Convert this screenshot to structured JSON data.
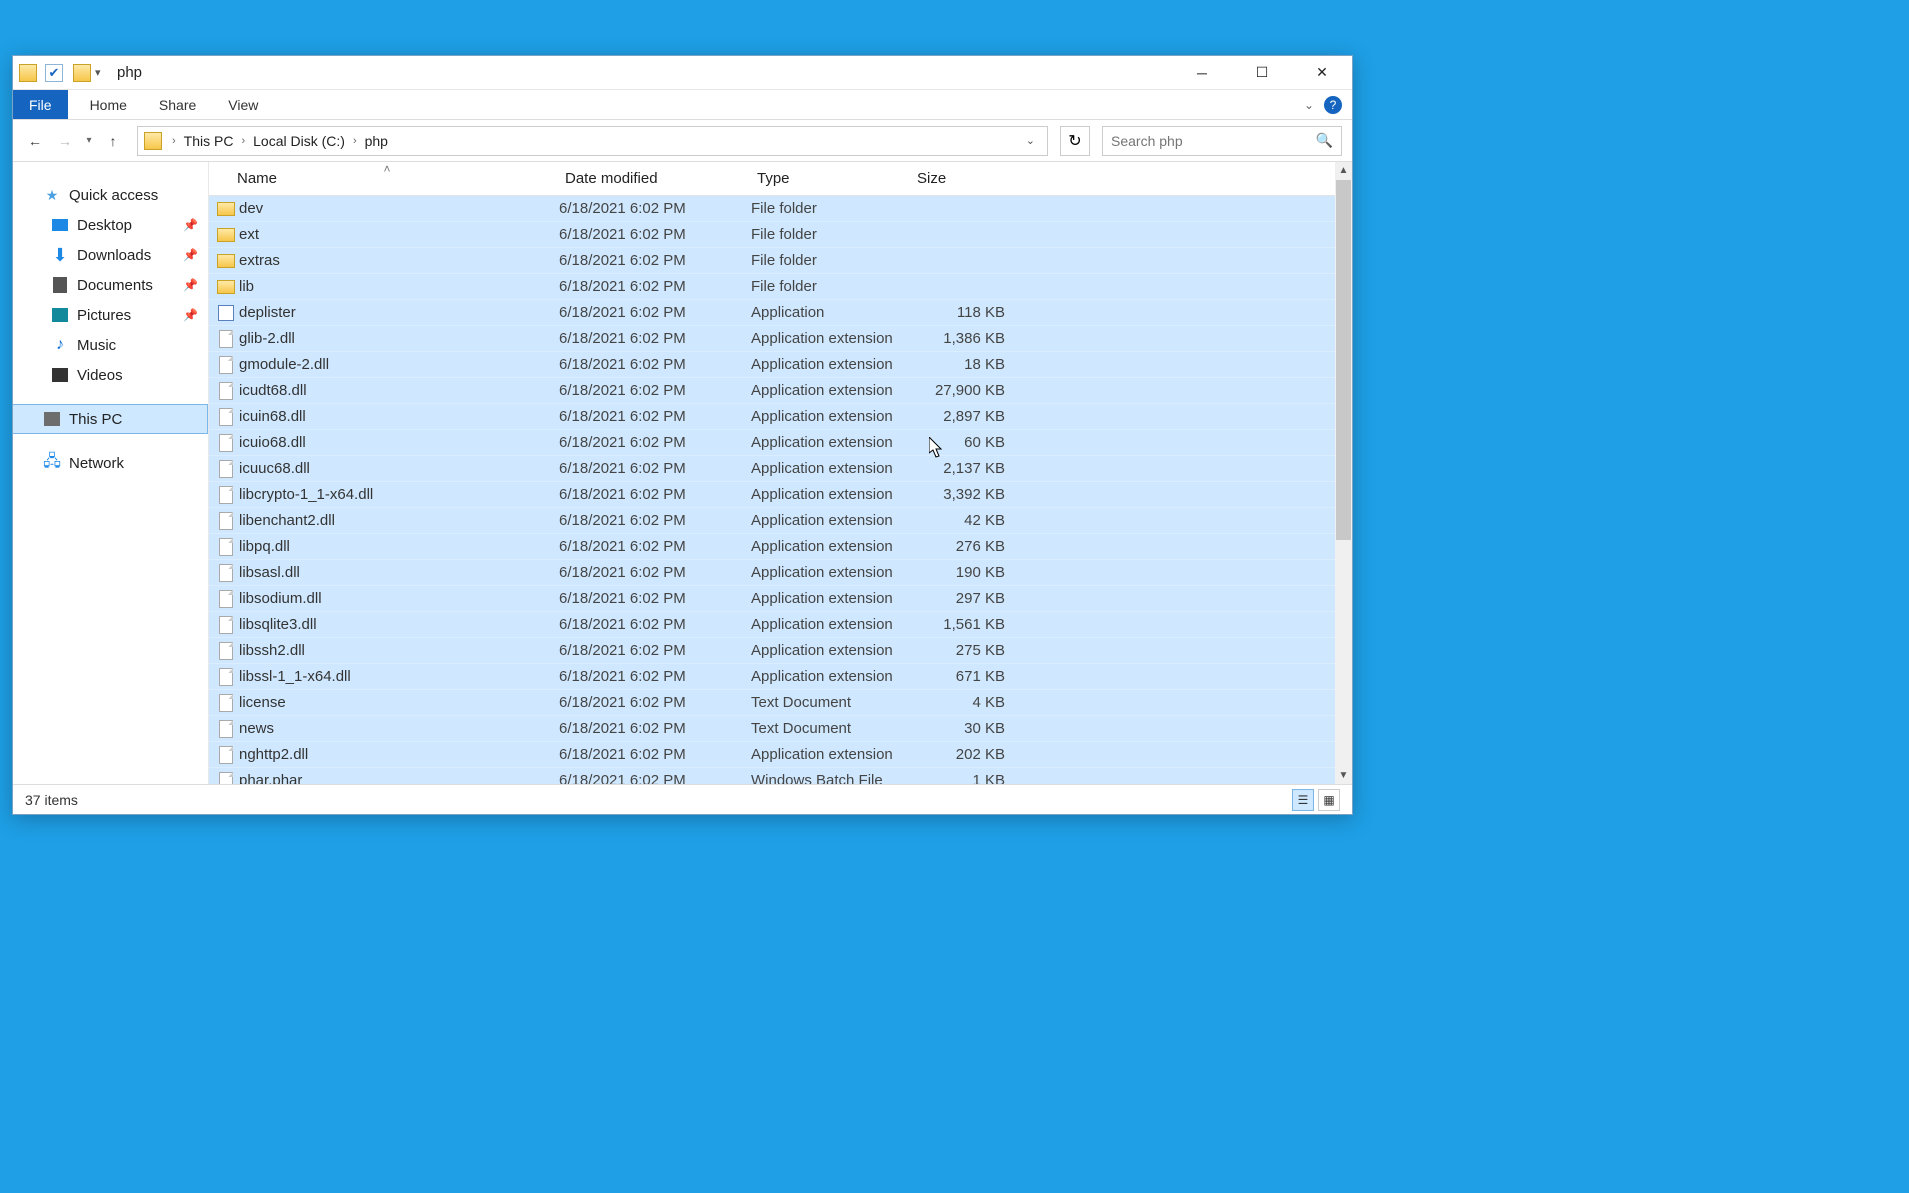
{
  "window_title": "php",
  "ribbon": {
    "file": "File",
    "home": "Home",
    "share": "Share",
    "view": "View"
  },
  "breadcrumb": {
    "items": [
      "This PC",
      "Local Disk (C:)",
      "php"
    ]
  },
  "search": {
    "placeholder": "Search php"
  },
  "nav_pane": {
    "quick_access": "Quick access",
    "desktop": "Desktop",
    "downloads": "Downloads",
    "documents": "Documents",
    "pictures": "Pictures",
    "music": "Music",
    "videos": "Videos",
    "this_pc": "This PC",
    "network": "Network"
  },
  "columns": {
    "name": "Name",
    "date": "Date modified",
    "type": "Type",
    "size": "Size"
  },
  "files": [
    {
      "icon": "folder",
      "name": "dev",
      "date": "6/18/2021 6:02 PM",
      "type": "File folder",
      "size": ""
    },
    {
      "icon": "folder",
      "name": "ext",
      "date": "6/18/2021 6:02 PM",
      "type": "File folder",
      "size": ""
    },
    {
      "icon": "folder",
      "name": "extras",
      "date": "6/18/2021 6:02 PM",
      "type": "File folder",
      "size": ""
    },
    {
      "icon": "folder",
      "name": "lib",
      "date": "6/18/2021 6:02 PM",
      "type": "File folder",
      "size": ""
    },
    {
      "icon": "exe",
      "name": "deplister",
      "date": "6/18/2021 6:02 PM",
      "type": "Application",
      "size": "118 KB"
    },
    {
      "icon": "file",
      "name": "glib-2.dll",
      "date": "6/18/2021 6:02 PM",
      "type": "Application extension",
      "size": "1,386 KB"
    },
    {
      "icon": "file",
      "name": "gmodule-2.dll",
      "date": "6/18/2021 6:02 PM",
      "type": "Application extension",
      "size": "18 KB"
    },
    {
      "icon": "file",
      "name": "icudt68.dll",
      "date": "6/18/2021 6:02 PM",
      "type": "Application extension",
      "size": "27,900 KB"
    },
    {
      "icon": "file",
      "name": "icuin68.dll",
      "date": "6/18/2021 6:02 PM",
      "type": "Application extension",
      "size": "2,897 KB"
    },
    {
      "icon": "file",
      "name": "icuio68.dll",
      "date": "6/18/2021 6:02 PM",
      "type": "Application extension",
      "size": "60 KB"
    },
    {
      "icon": "file",
      "name": "icuuc68.dll",
      "date": "6/18/2021 6:02 PM",
      "type": "Application extension",
      "size": "2,137 KB"
    },
    {
      "icon": "file",
      "name": "libcrypto-1_1-x64.dll",
      "date": "6/18/2021 6:02 PM",
      "type": "Application extension",
      "size": "3,392 KB"
    },
    {
      "icon": "file",
      "name": "libenchant2.dll",
      "date": "6/18/2021 6:02 PM",
      "type": "Application extension",
      "size": "42 KB"
    },
    {
      "icon": "file",
      "name": "libpq.dll",
      "date": "6/18/2021 6:02 PM",
      "type": "Application extension",
      "size": "276 KB"
    },
    {
      "icon": "file",
      "name": "libsasl.dll",
      "date": "6/18/2021 6:02 PM",
      "type": "Application extension",
      "size": "190 KB"
    },
    {
      "icon": "file",
      "name": "libsodium.dll",
      "date": "6/18/2021 6:02 PM",
      "type": "Application extension",
      "size": "297 KB"
    },
    {
      "icon": "file",
      "name": "libsqlite3.dll",
      "date": "6/18/2021 6:02 PM",
      "type": "Application extension",
      "size": "1,561 KB"
    },
    {
      "icon": "file",
      "name": "libssh2.dll",
      "date": "6/18/2021 6:02 PM",
      "type": "Application extension",
      "size": "275 KB"
    },
    {
      "icon": "file",
      "name": "libssl-1_1-x64.dll",
      "date": "6/18/2021 6:02 PM",
      "type": "Application extension",
      "size": "671 KB"
    },
    {
      "icon": "file",
      "name": "license",
      "date": "6/18/2021 6:02 PM",
      "type": "Text Document",
      "size": "4 KB"
    },
    {
      "icon": "file",
      "name": "news",
      "date": "6/18/2021 6:02 PM",
      "type": "Text Document",
      "size": "30 KB"
    },
    {
      "icon": "file",
      "name": "nghttp2.dll",
      "date": "6/18/2021 6:02 PM",
      "type": "Application extension",
      "size": "202 KB"
    },
    {
      "icon": "file",
      "name": "phar.phar",
      "date": "6/18/2021 6:02 PM",
      "type": "Windows Batch File",
      "size": "1 KB"
    }
  ],
  "status": {
    "items": "37 items"
  }
}
